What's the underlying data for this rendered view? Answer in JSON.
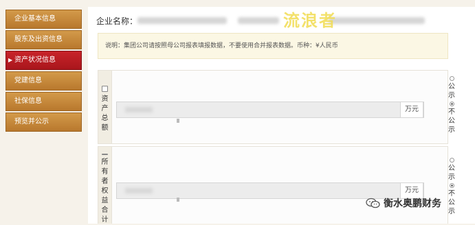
{
  "sidebar": {
    "items": [
      {
        "label": "企业基本信息"
      },
      {
        "label": "股东及出资信息"
      },
      {
        "label": "资产状况信息",
        "active": true
      },
      {
        "label": "党建信息"
      },
      {
        "label": "社保信息"
      },
      {
        "label": "预览并公示"
      }
    ],
    "active_arrow": "▶"
  },
  "header": {
    "company_label": "企业名称：",
    "watermark": "流浪者"
  },
  "notice": {
    "text": "说明：集团公司请按照母公司报表填报数据，不要使用合并报表数据。币种：¥人民币"
  },
  "fields": [
    {
      "label": "资产总额",
      "unit": "万元",
      "visibility_options": [
        "公示",
        "不公示"
      ],
      "selected": "不公示"
    },
    {
      "label": "所有者权益合计",
      "unit": "万元",
      "visibility_options": [
        "公示",
        "不公示"
      ],
      "selected": "不公示"
    }
  ],
  "brand": {
    "name": "衡水奥鹏财务",
    "icon": "wechat-icon"
  },
  "colors": {
    "sidebar_item": "#c4873b",
    "sidebar_active": "#b81d23",
    "notice_bg": "#fbf7e4",
    "watermark": "#f1dc52"
  }
}
